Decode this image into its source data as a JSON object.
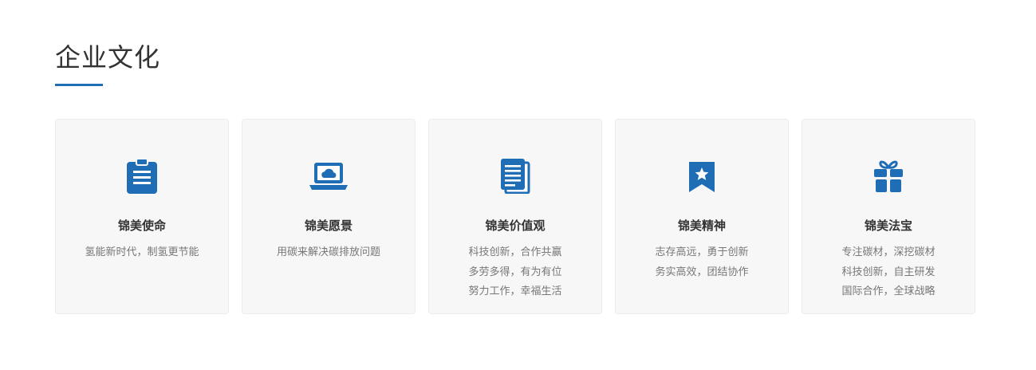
{
  "section": {
    "title": "企业文化"
  },
  "colors": {
    "accent": "#1f6db5",
    "card_bg": "#f7f7f7",
    "title_text": "#333333",
    "body_text": "#777777"
  },
  "cards": [
    {
      "icon": "clipboard-icon",
      "title": "锦美使命",
      "lines": [
        "氢能新时代，制氢更节能"
      ]
    },
    {
      "icon": "laptop-cloud-icon",
      "title": "锦美愿景",
      "lines": [
        "用碳来解决碳排放问题"
      ]
    },
    {
      "icon": "documents-icon",
      "title": "锦美价值观",
      "lines": [
        "科技创新，合作共赢",
        "多劳多得，有为有位",
        "努力工作，幸福生活"
      ]
    },
    {
      "icon": "star-bookmark-icon",
      "title": "锦美精神",
      "lines": [
        "志存高远，勇于创新",
        "务实高效，团结协作"
      ]
    },
    {
      "icon": "gift-icon",
      "title": "锦美法宝",
      "lines": [
        "专注碳材，深挖碳材",
        "科技创新，自主研发",
        "国际合作，全球战略"
      ]
    }
  ]
}
